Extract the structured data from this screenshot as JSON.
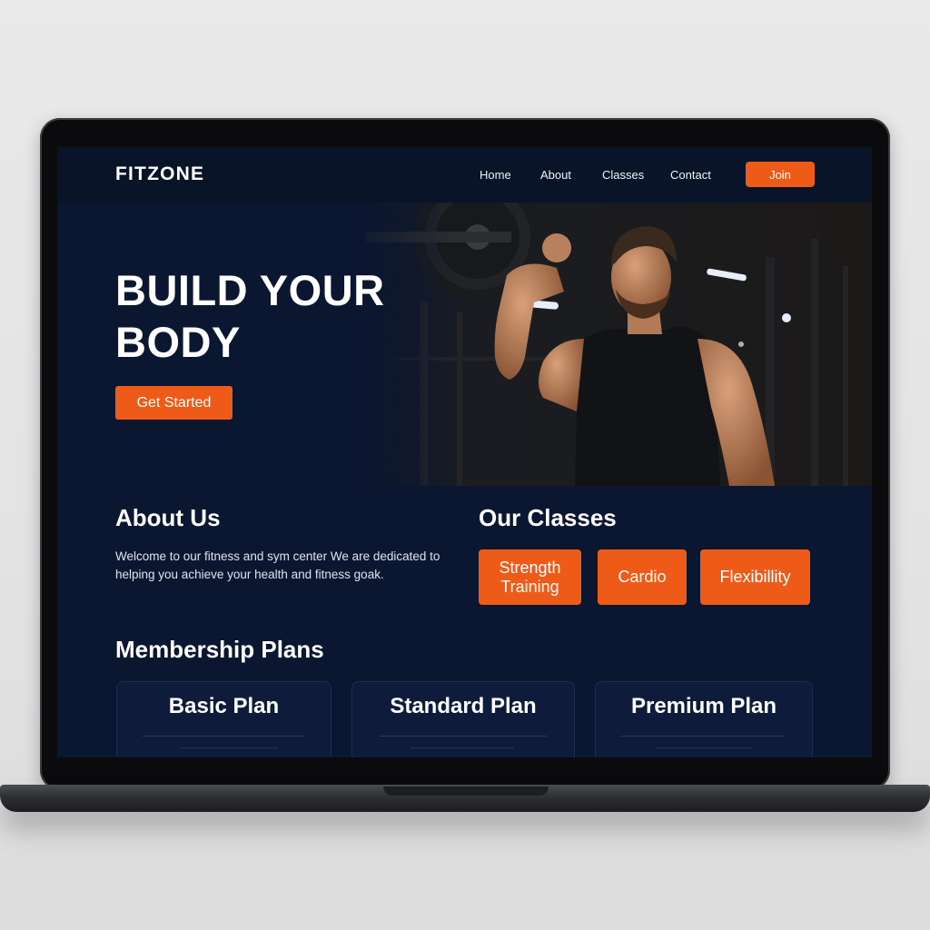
{
  "brand": {
    "name": "FITZONE",
    "accent": "#ee5a17",
    "background": "#0b1630"
  },
  "nav": {
    "links": [
      "Home",
      "About",
      "Classes",
      "Contact"
    ],
    "join_label": "Join"
  },
  "hero": {
    "title_line1": "BUILD YOUR",
    "title_line2": "BODY",
    "cta_label": "Get Started",
    "image": "man-lifting-barbell-photo"
  },
  "about": {
    "title": "About Us",
    "text": "Welcome to our fitness and sym center We are dedicated to helping you achieve your health and fitness goak."
  },
  "classes": {
    "title": "Our Classes",
    "items": [
      "Strength Training",
      "Cardio",
      "Flexibillity"
    ]
  },
  "plans": {
    "title": "Membership Plans",
    "items": [
      "Basic Plan",
      "Standard Plan",
      "Premium Plan"
    ]
  }
}
